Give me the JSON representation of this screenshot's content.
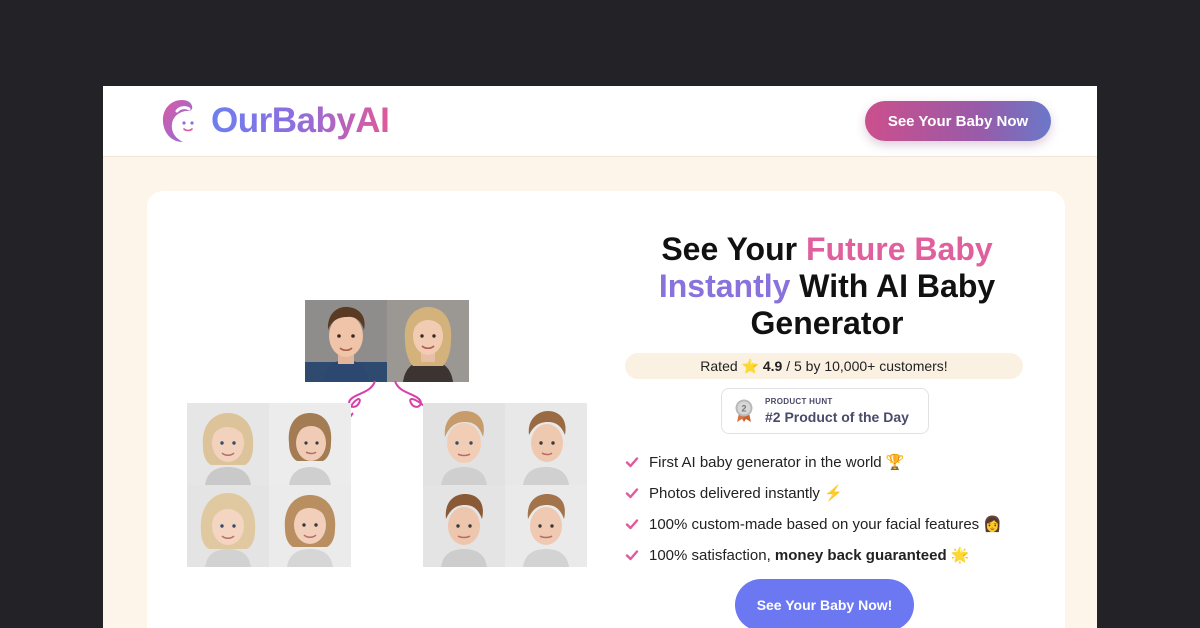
{
  "header": {
    "logo_text": "OurBabyAI",
    "cta_label": "See Your Baby Now"
  },
  "hero": {
    "title_part1": "See Your ",
    "title_highlight1": "Future Baby",
    "title_highlight2": "Instantly",
    "title_part2": " With AI Baby Generator",
    "rating_prefix": "Rated ⭐ ",
    "rating_value": "4.9",
    "rating_suffix": " / 5 by 10,000+ customers!",
    "badge_label": "PRODUCT HUNT",
    "badge_text": "#2 Product of the Day",
    "badge_rank": "2",
    "features": [
      {
        "text": "First AI baby generator in the world 🏆"
      },
      {
        "text": "Photos delivered instantly ⚡"
      },
      {
        "text": "100% custom-made based on your facial features 👩"
      },
      {
        "text": "100% satisfaction, ",
        "bold": "money back guaranteed",
        "after": " 🌟"
      }
    ],
    "cta_label": "See Your Baby Now!"
  },
  "images": {
    "parents": [
      {
        "alt": "father photo"
      },
      {
        "alt": "mother photo"
      }
    ],
    "children_girls": [
      "girl photo 1",
      "girl photo 2",
      "girl photo 3",
      "girl photo 4"
    ],
    "children_boys": [
      "boy photo 1",
      "boy photo 2",
      "boy photo 3",
      "boy photo 4"
    ]
  },
  "colors": {
    "accent_pink": "#e0609e",
    "accent_purple": "#8a72dc",
    "cta_blue": "#6c78f2",
    "arrow_magenta": "#d93fa8",
    "check_pink": "#e25a9c"
  }
}
